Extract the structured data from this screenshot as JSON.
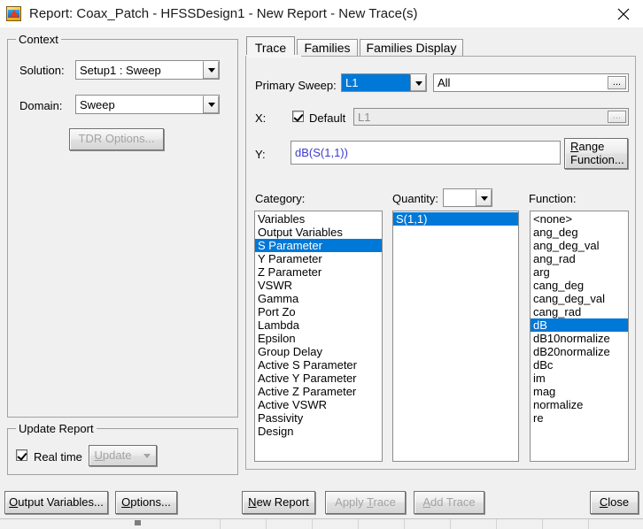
{
  "window": {
    "title": "Report: Coax_Patch - HFSSDesign1 - New Report - New Trace(s)",
    "icon": "hfss-app-icon",
    "close_label": "✕"
  },
  "context": {
    "legend": "Context",
    "solution_label": "Solution:",
    "solution_value": "Setup1 : Sweep",
    "domain_label": "Domain:",
    "domain_value": "Sweep",
    "tdr_button": "TDR Options..."
  },
  "update_report": {
    "legend": "Update Report",
    "realtime_label": "Real time",
    "realtime_checked": true,
    "update_button": "Update"
  },
  "bottom_left_buttons": {
    "output_variables": "Output Variables...",
    "options": "Options..."
  },
  "bottom_buttons": {
    "new_report": "New Report",
    "apply_trace": "Apply Trace",
    "add_trace": "Add Trace",
    "close": "Close"
  },
  "tabs": [
    {
      "label": "Trace",
      "active": true
    },
    {
      "label": "Families",
      "active": false
    },
    {
      "label": "Families Display",
      "active": false
    }
  ],
  "trace": {
    "primary_sweep_label": "Primary Sweep:",
    "primary_sweep_value": "L1",
    "primary_sweep_range": "All",
    "range_ellipsis": "...",
    "x_label": "X:",
    "x_default_label": "Default",
    "x_default_checked": true,
    "x_value": "L1",
    "x_ellipsis": "...",
    "y_label": "Y:",
    "y_value": "dB(S(1,1))",
    "range_function_button_line1": "Range",
    "range_function_button_line2": "Function...",
    "category_label": "Category:",
    "quantity_label": "Quantity:",
    "quantity_value": "",
    "function_label": "Function:",
    "category_items": [
      "Variables",
      "Output Variables",
      "S Parameter",
      "Y Parameter",
      "Z Parameter",
      "VSWR",
      "Gamma",
      "Port Zo",
      "Lambda",
      "Epsilon",
      "Group Delay",
      "Active S Parameter",
      "Active Y Parameter",
      "Active Z Parameter",
      "Active VSWR",
      "Passivity",
      "Design"
    ],
    "category_selected": "S Parameter",
    "quantity_items": [
      "S(1,1)"
    ],
    "quantity_selected": "S(1,1)",
    "function_items": [
      "<none>",
      "ang_deg",
      "ang_deg_val",
      "ang_rad",
      "arg",
      "cang_deg",
      "cang_deg_val",
      "cang_rad",
      "dB",
      "dB10normalize",
      "dB20normalize",
      "dBc",
      "im",
      "mag",
      "normalize",
      "re"
    ],
    "function_selected": "dB"
  },
  "colors": {
    "selection_blue": "#0078d7",
    "dialog_face": "#f0f0f0",
    "y_expression_text": "#3b3bd0",
    "disabled_text": "#a3a3a3"
  }
}
